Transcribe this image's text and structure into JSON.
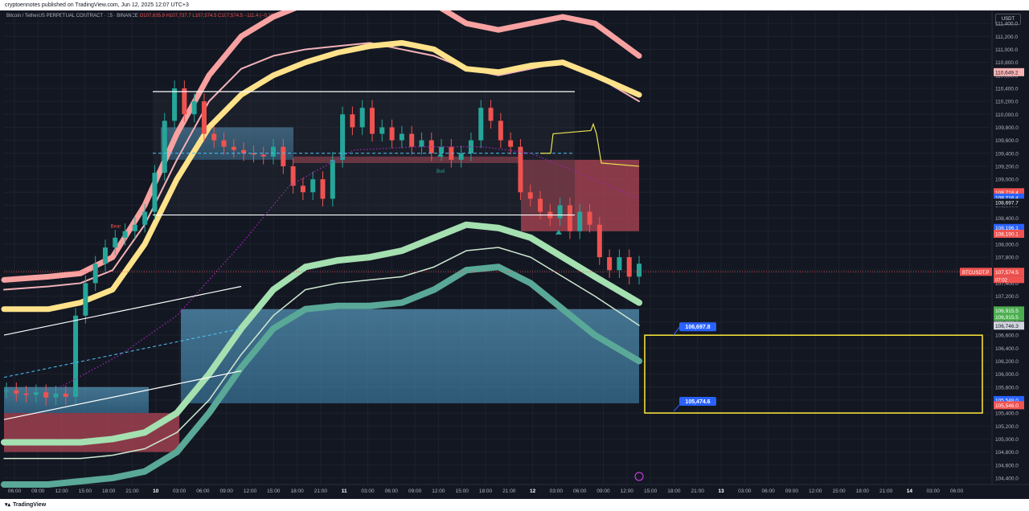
{
  "header": {
    "published": "cryptoennotes published on TradingView.com, Jun 12, 2025 12:07 UTC+3"
  },
  "legend": {
    "symbol": "Bitcoin / TetherUS PERPETUAL CONTRACT · 15 · BINANCE",
    "o": "O107,685.9",
    "h": "H107,737.7",
    "l": "L107,574.5",
    "c": "C107,574.5",
    "chg": "−111.4 (−0.10%)"
  },
  "currency": "USDT",
  "footer": {
    "brand": "TradingView",
    "logo": "tv-logo-icon"
  },
  "chart_data": {
    "type": "line",
    "title": "Bitcoin / TetherUS PERPETUAL CONTRACT · 15 · BINANCE",
    "ylim": [
      104300,
      111550
    ],
    "y_ticks": [
      104400,
      104600,
      104800,
      105000,
      105200,
      105400,
      105600,
      105800,
      106000,
      106200,
      106400,
      106600,
      106800,
      107000,
      107200,
      107400,
      107600,
      107800,
      108000,
      108200,
      108400,
      108600,
      108800,
      109000,
      109200,
      109400,
      109600,
      109800,
      110000,
      110200,
      110400,
      110600,
      110800,
      111000,
      111200,
      111400
    ],
    "x_ticks": [
      "06:00",
      "09:00",
      "12:00",
      "15:00",
      "18:00",
      "21:00",
      "10",
      "03:00",
      "06:00",
      "09:00",
      "12:00",
      "15:00",
      "18:00",
      "21:00",
      "11",
      "03:00",
      "06:00",
      "09:00",
      "12:00",
      "15:00",
      "18:00",
      "21:00",
      "12",
      "03:00",
      "06:00",
      "09:00",
      "12:00",
      "15:00",
      "18:00",
      "21:00",
      "13",
      "03:00",
      "06:00",
      "09:00",
      "12:00",
      "15:00",
      "18:00",
      "21:00",
      "14",
      "03:00",
      "06:00"
    ],
    "price": [
      105750,
      105700,
      105680,
      105720,
      105640,
      105700,
      105650,
      106900,
      107400,
      107700,
      107950,
      108100,
      108200,
      108300,
      108500,
      109100,
      109900,
      110400,
      110000,
      110200,
      109700,
      109600,
      109500,
      109450,
      109400,
      109380,
      109350,
      109500,
      109200,
      108900,
      108800,
      109000,
      108700,
      109300,
      110000,
      109800,
      110100,
      109700,
      109800,
      109600,
      109700,
      109500,
      109600,
      109400,
      109500,
      109300,
      109400,
      109600,
      110100,
      109900,
      109600,
      109500,
      108800,
      108700,
      108500,
      108400,
      108600,
      108200,
      108500,
      108300,
      107800,
      107600,
      107800,
      107500,
      107700
    ],
    "range_box": {
      "high": 110350,
      "low": 108450
    },
    "price_labels": [
      "111,400.0",
      "110,649.2",
      "108,718.4",
      "108,716.4",
      "108,697.7",
      "108,196.1",
      "108,190.1",
      "107,574.5",
      "106,915.5",
      "106,915.5",
      "106,746.3",
      "105,548.0",
      "105,546.0"
    ],
    "current_price": "107,574.5",
    "current_symbol": "BTCUSDT.P",
    "countdown": "07:02",
    "zone": {
      "upper": 106697.8,
      "lower": 105474.6,
      "upper_label": "106,697.8",
      "lower_label": "105,474.6"
    },
    "annotations": [
      "Bear",
      "Bull"
    ],
    "colors": {
      "bull": "#26a69a",
      "bear": "#ef5350",
      "band_top": "#f8a1a1",
      "band_yellow": "#ffe28a",
      "band_green": "#a5e0b0",
      "band_teal": "#5aa897",
      "cloud_blue": "#4a8fb5",
      "cloud_red": "#a84452",
      "zone": "#ffeb3b",
      "label_blue": "#2962ff"
    }
  }
}
